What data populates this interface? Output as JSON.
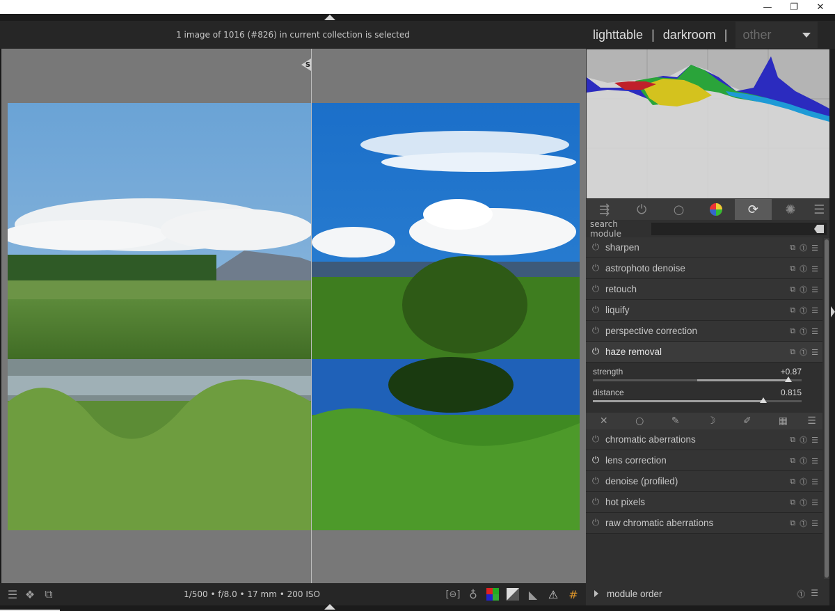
{
  "window": {
    "minimize": "—",
    "restore": "❐",
    "close": "✕"
  },
  "header": {
    "status": "1 image of 1016 (#826) in current collection is selected",
    "views": {
      "lighttable": "lighttable",
      "sep1": "|",
      "darkroom": "darkroom",
      "sep2": "|",
      "other": "other"
    }
  },
  "image": {
    "split_handle": "S"
  },
  "bottombar": {
    "exif": "1/500 • f/8.0 • 17 mm • 200 ISO"
  },
  "histogram": {
    "colors": [
      "#e05a1a",
      "#d4c21e",
      "#2aa43a",
      "#1e9ad6",
      "#2b2bbf",
      "#c01e8a"
    ]
  },
  "module_groups": {
    "tabs": [
      {
        "icon": "quick-access-icon",
        "glyph": "⇶"
      },
      {
        "icon": "power-icon",
        "glyph": "⏻"
      },
      {
        "icon": "circle-icon",
        "glyph": "○"
      },
      {
        "icon": "color-wheel-icon",
        "glyph": "●"
      },
      {
        "icon": "correct-icon",
        "glyph": "⟳"
      },
      {
        "icon": "effect-icon",
        "glyph": "✺"
      },
      {
        "icon": "menu-icon",
        "glyph": "☰"
      }
    ]
  },
  "search": {
    "label": "search module"
  },
  "modules_top": [
    {
      "name": "sharpen",
      "on": false
    },
    {
      "name": "astrophoto denoise",
      "on": false
    },
    {
      "name": "retouch",
      "on": false
    },
    {
      "name": "liquify",
      "on": false
    },
    {
      "name": "perspective correction",
      "on": false
    }
  ],
  "expanded_module": {
    "name": "haze removal",
    "on": true,
    "sliders": [
      {
        "label": "strength",
        "value": "+0.87",
        "fraction": 0.935
      },
      {
        "label": "distance",
        "value": "0.815",
        "fraction": 0.815
      }
    ]
  },
  "modules_bottom": [
    {
      "name": "chromatic aberrations",
      "on": false
    },
    {
      "name": "lens correction",
      "on": true
    },
    {
      "name": "denoise (profiled)",
      "on": false
    },
    {
      "name": "hot pixels",
      "on": false
    },
    {
      "name": "raw chromatic aberrations",
      "on": false
    }
  ],
  "module_order": {
    "label": "module order"
  }
}
